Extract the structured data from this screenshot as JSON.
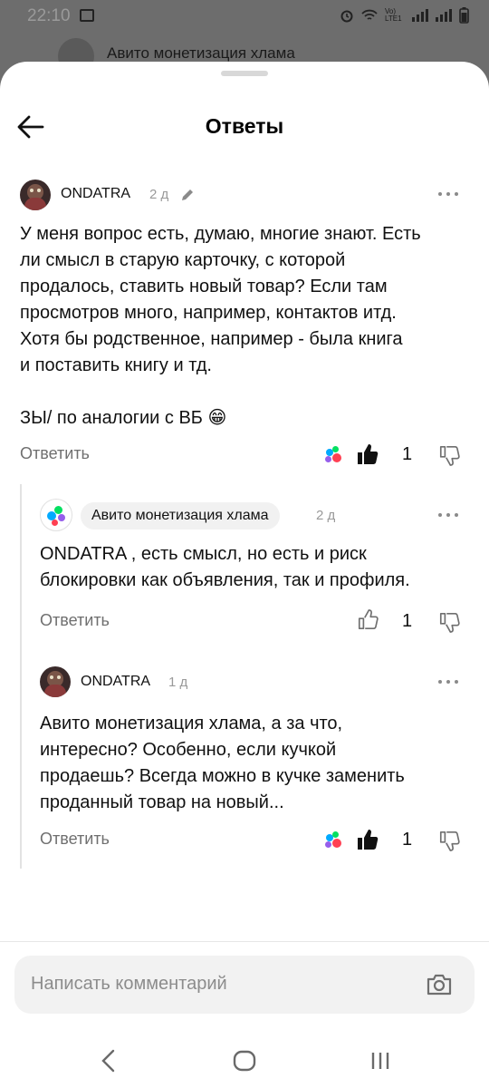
{
  "status_bar": {
    "time": "22:10",
    "network_label": "Vo) LTE1"
  },
  "background": {
    "chat_title": "Авито монетизация хлама"
  },
  "sheet": {
    "title": "Ответы"
  },
  "comments": [
    {
      "author": "ONDATRA",
      "time": "2 д",
      "edited": true,
      "text_lines": [
        "У меня вопрос есть, думаю, многие знают. Есть",
        "ли смысл в старую карточку, с которой",
        "продалось, ставить новый товар? Если там",
        "просмотров много, например, контактов итд.",
        "Хотя бы родственное, например - была книга",
        "и поставить книгу и тд.",
        "",
        "ЗЫ/ по аналогии с ВБ 😁"
      ],
      "reply_label": "Ответить",
      "likes": "1",
      "liked": true
    },
    {
      "author": "Авито монетизация хлама",
      "time": "2 д",
      "text_lines": [
        "ONDATRA , есть смысл, но есть и риск",
        "блокировки как объявления, так и профиля."
      ],
      "reply_label": "Ответить",
      "likes": "1",
      "liked": false
    },
    {
      "author": "ONDATRA",
      "time": "1 д",
      "text_lines": [
        "Авито монетизация хлама, а за что,",
        "интересно? Особенно, если кучкой",
        "продаешь? Всегда можно в кучке заменить",
        "проданный товар на новый..."
      ],
      "reply_label": "Ответить",
      "likes": "1",
      "liked": true
    }
  ],
  "input": {
    "placeholder": "Написать комментарий"
  },
  "icons": {
    "back": "arrow-left-icon",
    "edit": "pencil-icon",
    "more": "more-horizontal-icon",
    "like": "thumb-up-icon",
    "dislike": "thumb-down-icon",
    "camera": "camera-icon",
    "nav_back": "chevron-left-icon",
    "nav_home": "home-icon",
    "nav_recents": "recents-icon"
  },
  "colors": {
    "avito_green": "#04e061",
    "avito_blue": "#00aaff",
    "avito_purple": "#965eeb",
    "avito_red": "#ff4053"
  }
}
